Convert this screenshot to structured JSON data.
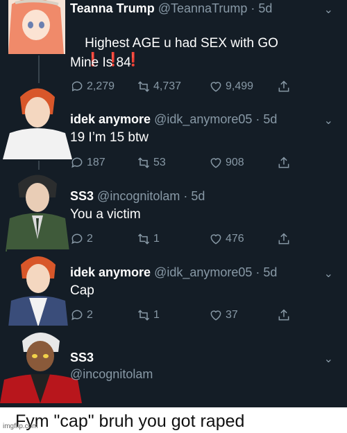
{
  "tweets": [
    {
      "name": "Teanna Trump",
      "handle_time": "@TeannaTrump · 5d",
      "text": "Highest AGE u had SEX with GO",
      "emoji": "❗ ❗ ❗",
      "text2": "Mine Is 84",
      "replies": "2,279",
      "retweets": "4,737",
      "likes": "9,499"
    },
    {
      "name": "idek anymore",
      "handle_time": "@idk_anymore05 · 5d",
      "text": "19 I’m 15 btw",
      "replies": "187",
      "retweets": "53",
      "likes": "908"
    },
    {
      "name": "SS3",
      "handle_time": "@incognitolam · 5d",
      "text": "You a victim",
      "replies": "2",
      "retweets": "1",
      "likes": "476"
    },
    {
      "name": "idek anymore",
      "handle_time": "@idk_anymore05 · 5d",
      "text": "Cap",
      "replies": "2",
      "retweets": "1",
      "likes": "37"
    },
    {
      "name": "SS3",
      "handle": "@incognitolam"
    }
  ],
  "caption": "Fym \"cap\" bruh you got raped",
  "watermark": "imgflip.com",
  "colors": {
    "background": "#141d26",
    "secondary": "#8899a6",
    "exclaim": "#e0245e"
  },
  "icons": [
    "reply-icon",
    "retweet-icon",
    "like-icon",
    "share-icon",
    "chevron-down-icon"
  ]
}
